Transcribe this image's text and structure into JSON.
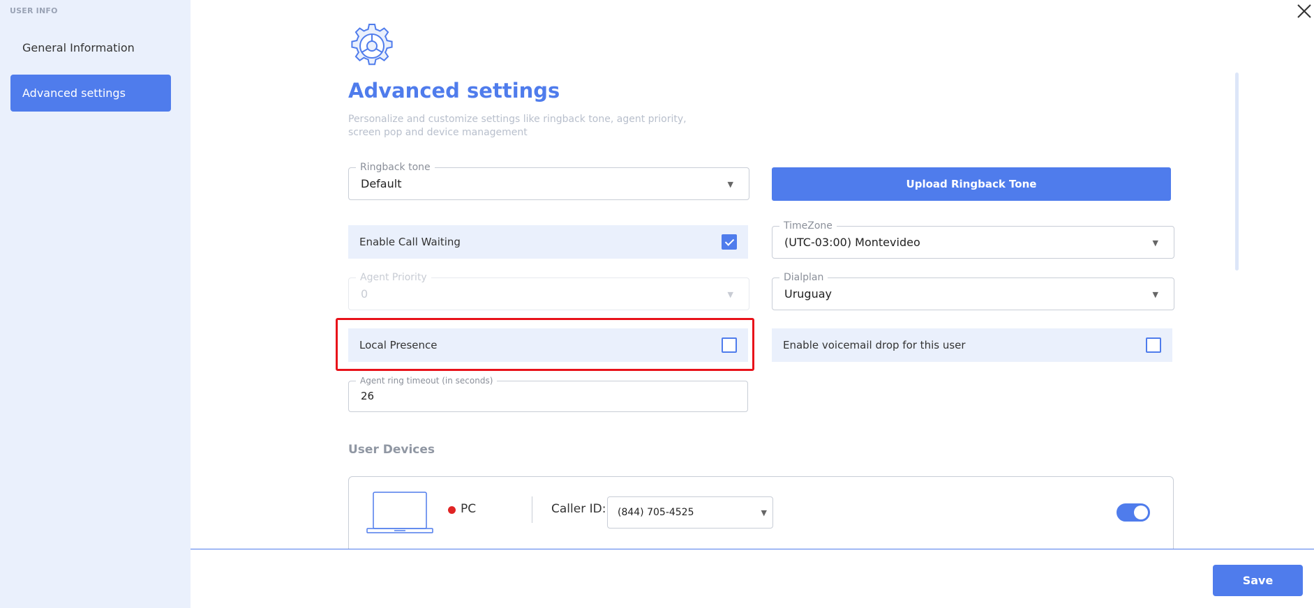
{
  "sidebar": {
    "title": "USER INFO",
    "items": [
      {
        "label": "General Information",
        "active": false
      },
      {
        "label": "Advanced settings",
        "active": true
      }
    ]
  },
  "header": {
    "title": "Advanced settings",
    "description": "Personalize and customize settings like ringback tone, agent priority, screen pop and device management"
  },
  "form": {
    "ringback": {
      "label": "Ringback tone",
      "value": "Default"
    },
    "upload_button": "Upload Ringback Tone",
    "call_waiting": {
      "label": "Enable Call Waiting",
      "checked": true
    },
    "timezone": {
      "label": "TimeZone",
      "value": "(UTC-03:00) Montevideo"
    },
    "agent_priority": {
      "label": "Agent Priority",
      "value": "0",
      "disabled": true
    },
    "dialplan": {
      "label": "Dialplan",
      "value": "Uruguay"
    },
    "local_presence": {
      "label": "Local Presence",
      "checked": false
    },
    "voicemail_drop": {
      "label": "Enable voicemail drop for this user",
      "checked": false
    },
    "ring_timeout": {
      "label": "Agent ring timeout (in seconds)",
      "value": "26"
    }
  },
  "devices": {
    "section_title": "User Devices",
    "items": [
      {
        "name": "PC",
        "status_color": "#e02424",
        "caller_id_label": "Caller ID:",
        "caller_id": "(844) 705-4525",
        "enabled": true
      }
    ]
  },
  "footer": {
    "save_label": "Save"
  },
  "theme": {
    "accent": "#4f7cec",
    "highlight": "#e8121a",
    "panel": "#eaf0fc"
  }
}
